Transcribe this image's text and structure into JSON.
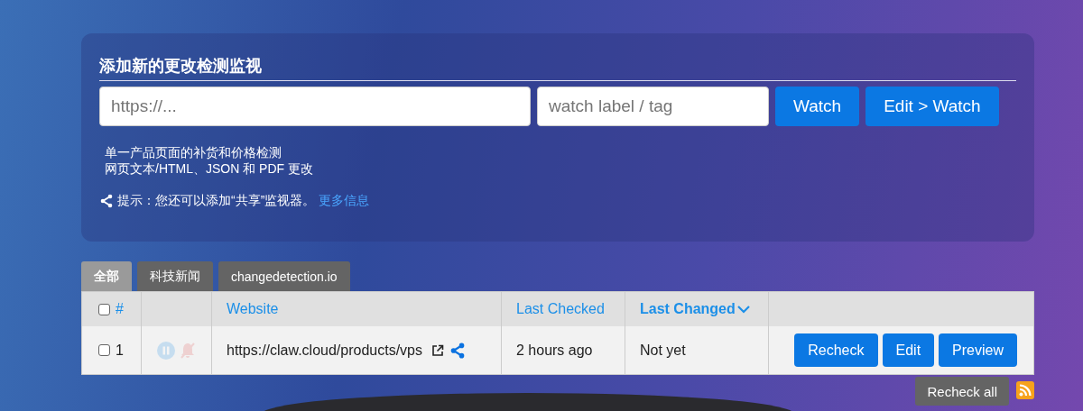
{
  "add_panel": {
    "title": "添加新的更改检测监视",
    "url_field": {
      "placeholder": "https://..."
    },
    "tag_field": {
      "placeholder": "watch label / tag"
    },
    "buttons": [
      "Watch",
      "Edit > Watch"
    ],
    "features": [
      "单一产品页面的补货和价格检测",
      "网页文本/HTML、JSON 和 PDF 更改"
    ],
    "tip": {
      "text": "提示：您还可以添加“共享”监视器。",
      "link": "更多信息"
    }
  },
  "tabs": [
    {
      "label": "全部",
      "selected": true
    },
    {
      "label": "科技新闻",
      "selected": false
    },
    {
      "label": "changedetection.io",
      "selected": false
    }
  ],
  "table": {
    "select_all": {
      "checked": false
    },
    "columns": [
      {
        "label": "#",
        "sorted": false
      },
      {
        "label": "Website",
        "sorted": false
      },
      {
        "label": "Last Checked",
        "sorted": false
      },
      {
        "label": "Last Changed",
        "sorted": true
      }
    ],
    "rows": [
      {
        "checked": false,
        "number": "1",
        "paused": false,
        "muted": false,
        "website": "https://claw.cloud/products/vps",
        "last_checked": "2 hours ago",
        "last_changed": "Not yet",
        "actions": [
          "Recheck",
          "Edit",
          "Preview"
        ]
      }
    ]
  },
  "recheck_all": "Recheck all"
}
